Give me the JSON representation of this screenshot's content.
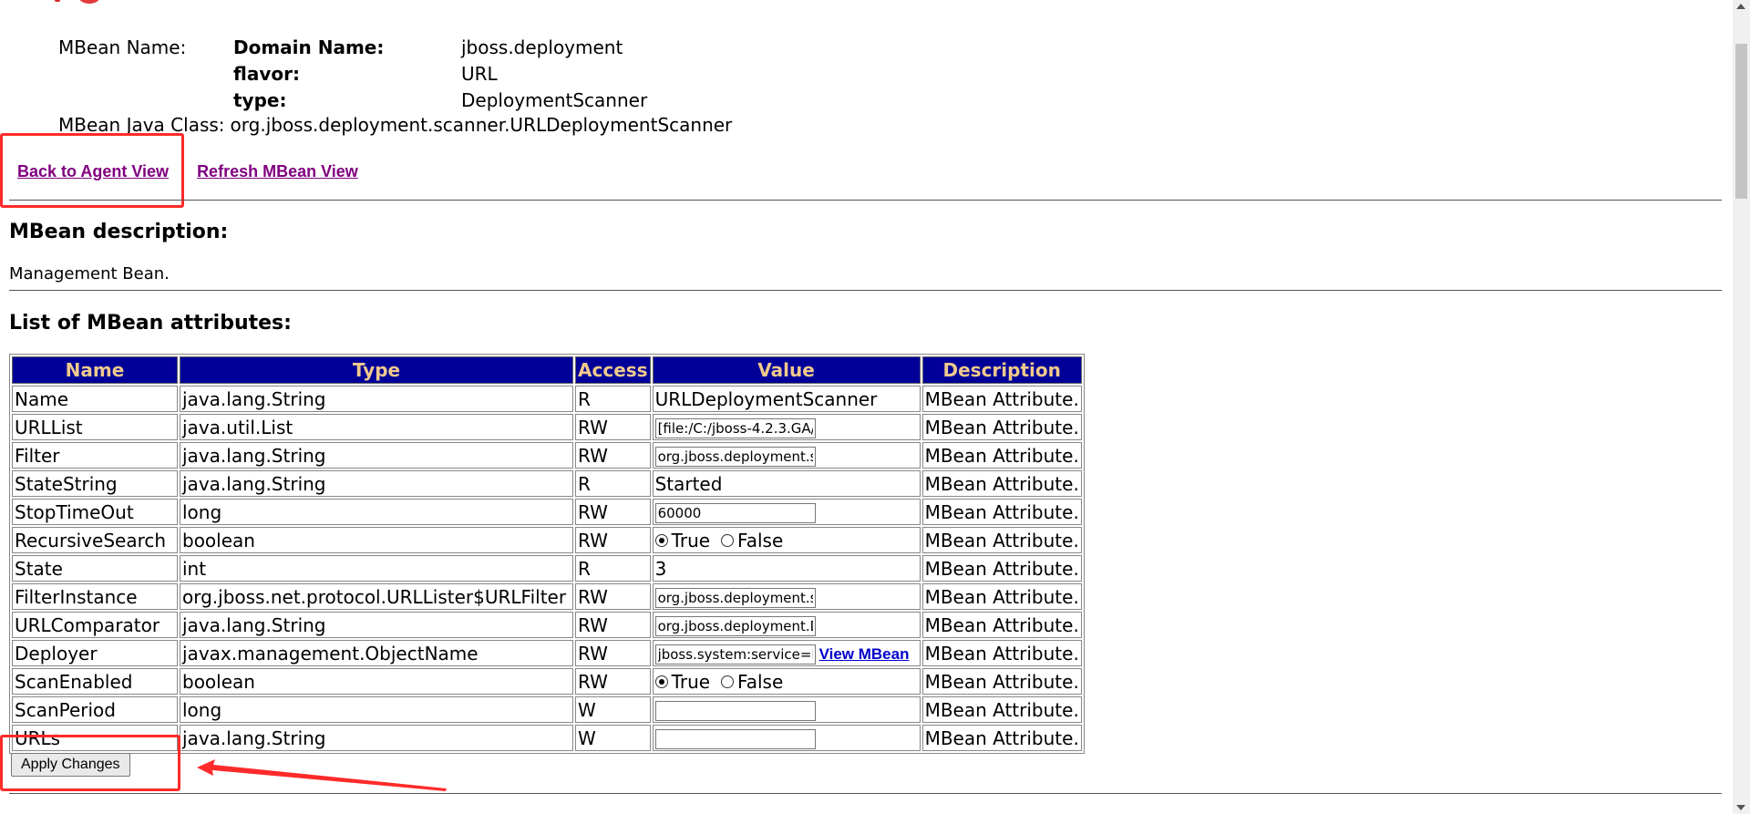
{
  "header": {
    "mbean_name_label": "MBean Name:",
    "rows": [
      {
        "key": "Domain Name:",
        "value": "jboss.deployment"
      },
      {
        "key": "flavor:",
        "value": "URL"
      },
      {
        "key": "type:",
        "value": "DeploymentScanner"
      }
    ],
    "java_class_label": "MBean Java Class:",
    "java_class_value": "org.jboss.deployment.scanner.URLDeploymentScanner"
  },
  "links": {
    "back": "Back to Agent View",
    "refresh": "Refresh MBean View"
  },
  "description": {
    "title": "MBean description:",
    "text": "Management Bean."
  },
  "attributes": {
    "title": "List of MBean attributes:",
    "columns": [
      "Name",
      "Type",
      "Access",
      "Value",
      "Description"
    ],
    "rows": [
      {
        "name": "Name",
        "type": "java.lang.String",
        "access": "R",
        "value": "URLDeploymentScanner",
        "desc": "MBean Attribute."
      },
      {
        "name": "URLList",
        "type": "java.util.List",
        "access": "RW",
        "value": "[file:/C:/jboss-4.2.3.GA/",
        "desc": "MBean Attribute."
      },
      {
        "name": "Filter",
        "type": "java.lang.String",
        "access": "RW",
        "value": "org.jboss.deployment.sc",
        "desc": "MBean Attribute."
      },
      {
        "name": "StateString",
        "type": "java.lang.String",
        "access": "R",
        "value": "Started",
        "desc": "MBean Attribute."
      },
      {
        "name": "StopTimeOut",
        "type": "long",
        "access": "RW",
        "value": "60000",
        "desc": "MBean Attribute."
      },
      {
        "name": "RecursiveSearch",
        "type": "boolean",
        "access": "RW",
        "value": "",
        "desc": "MBean Attribute."
      },
      {
        "name": "State",
        "type": "int",
        "access": "R",
        "value": "3",
        "desc": "MBean Attribute."
      },
      {
        "name": "FilterInstance",
        "type": "org.jboss.net.protocol.URLLister$URLFilter",
        "access": "RW",
        "value": "org.jboss.deployment.sc",
        "desc": "MBean Attribute."
      },
      {
        "name": "URLComparator",
        "type": "java.lang.String",
        "access": "RW",
        "value": "org.jboss.deployment.D",
        "desc": "MBean Attribute."
      },
      {
        "name": "Deployer",
        "type": "javax.management.ObjectName",
        "access": "RW",
        "value": "jboss.system:service=M",
        "desc": "MBean Attribute."
      },
      {
        "name": "ScanEnabled",
        "type": "boolean",
        "access": "RW",
        "value": "",
        "desc": "MBean Attribute."
      },
      {
        "name": "ScanPeriod",
        "type": "long",
        "access": "W",
        "value": "",
        "desc": "MBean Attribute."
      },
      {
        "name": "URLs",
        "type": "java.lang.String",
        "access": "W",
        "value": "",
        "desc": "MBean Attribute."
      }
    ],
    "radio_true": "True",
    "radio_false": "False",
    "view_mbean": "View MBean"
  },
  "apply_button": "Apply Changes",
  "colors": {
    "header_bg": "#000099",
    "header_text": "#f0c98c",
    "visited_link": "#800080",
    "annotation": "#ff2a2a"
  }
}
